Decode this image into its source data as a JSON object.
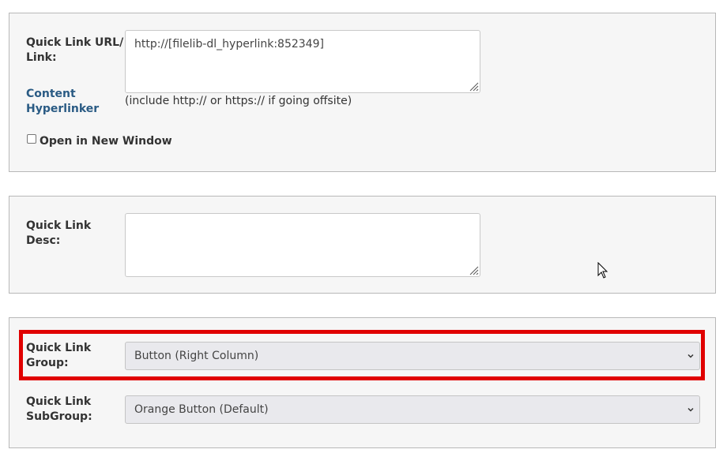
{
  "quick_link": {
    "url_label": "Quick Link URL/ Link:",
    "url_label_line1": "Quick Link URL/",
    "url_label_line2": "Link:",
    "url_value": "http://[filelib-dl_hyperlink:852349]",
    "content_hyperlinker_line1": "Content",
    "content_hyperlinker_line2": "Hyperlinker",
    "url_hint": "(include http:// or https:// if going offsite)",
    "open_new_window_label": "Open in New Window",
    "open_new_window_checked": false
  },
  "description": {
    "label_line1": "Quick Link",
    "label_line2": "Desc:",
    "value": ""
  },
  "group": {
    "label_line1": "Quick Link",
    "label_line2": "Group:",
    "selected": "Button (Right Column)"
  },
  "subgroup": {
    "label_line1": "Quick Link",
    "label_line2": "SubGroup:",
    "selected": "Orange Button (Default)"
  },
  "colors": {
    "highlight": "#e00000",
    "link": "#2a5b84",
    "panel_bg": "#f6f6f6"
  }
}
